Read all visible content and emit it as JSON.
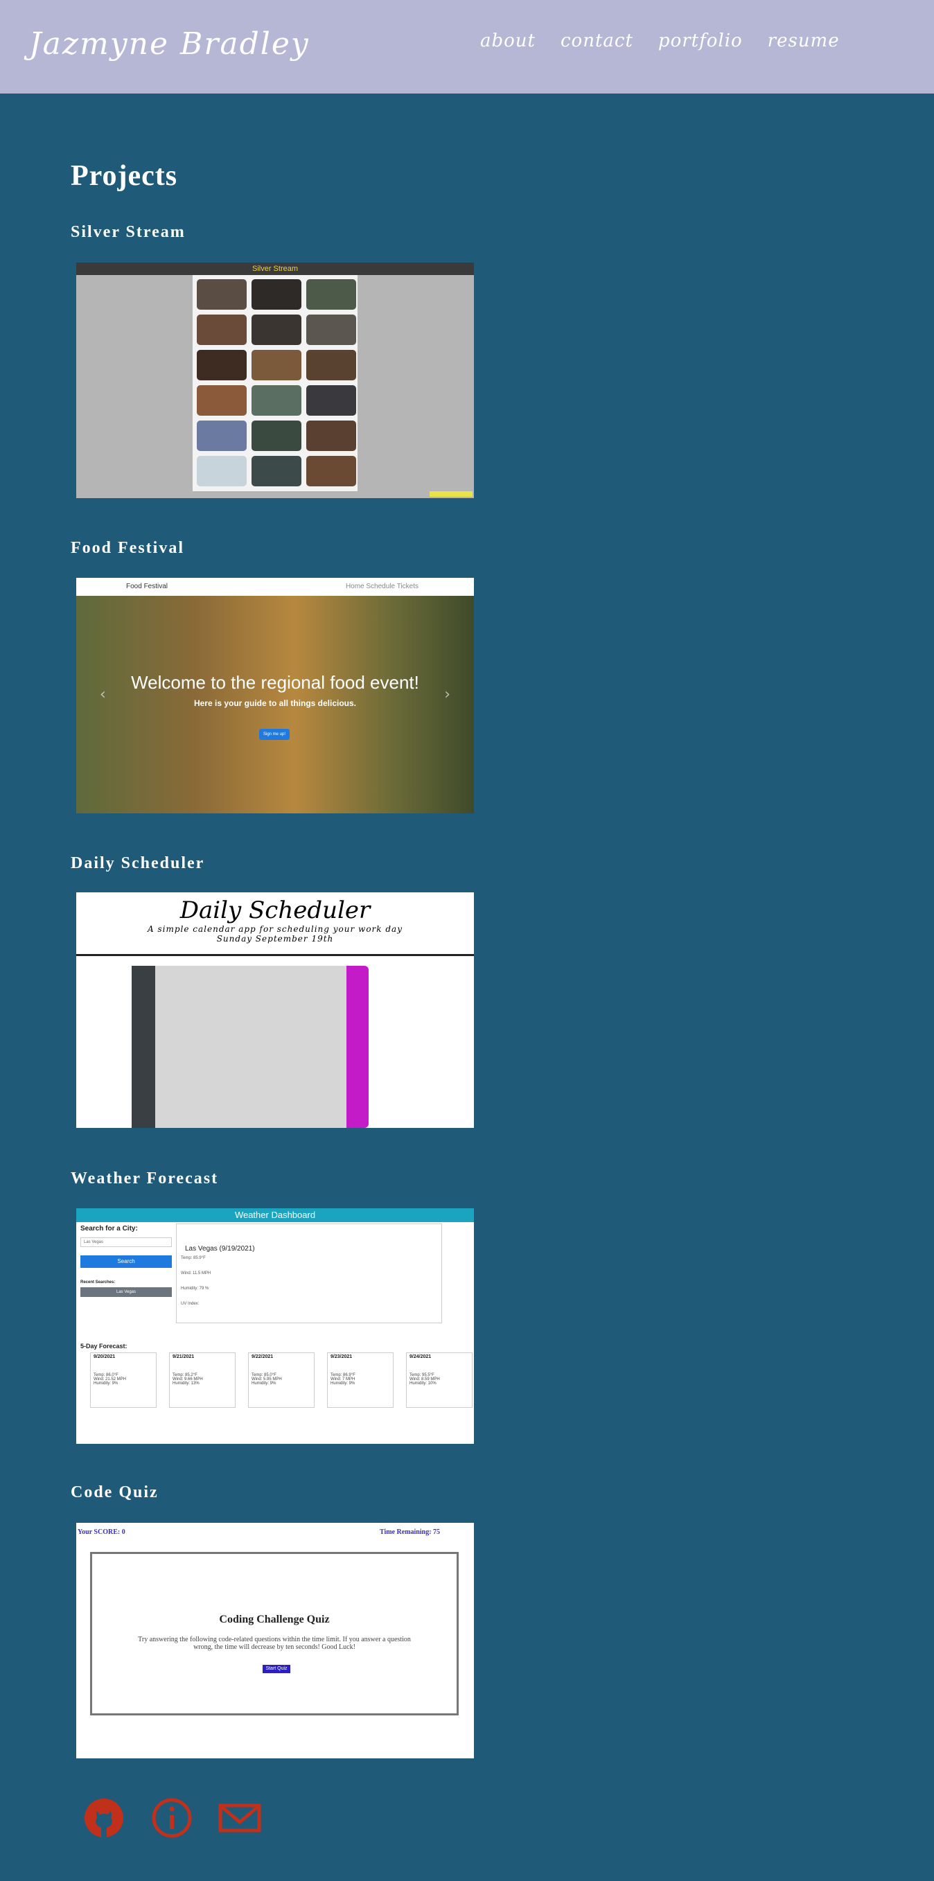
{
  "header": {
    "brand": "Jazmyne Bradley",
    "nav": [
      "about",
      "contact",
      "portfolio",
      "resume"
    ]
  },
  "main": {
    "title": "Projects",
    "projects": [
      {
        "title": "Silver Stream",
        "preview": {
          "bar": "Silver Stream"
        }
      },
      {
        "title": "Food Festival",
        "preview": {
          "brand": "Food Festival",
          "links": "Home  Schedule  Tickets",
          "headline": "Welcome to the regional food event!",
          "subhead": "Here is your guide to all things delicious.",
          "button": "Sign me up!"
        }
      },
      {
        "title": "Daily Scheduler",
        "preview": {
          "heading": "Daily Scheduler",
          "subtitle": "A simple calendar app for scheduling your work day",
          "date": "Sunday September 19th"
        }
      },
      {
        "title": "Weather Forecast",
        "preview": {
          "bar": "Weather Dashboard",
          "search_label": "Search for a City:",
          "search_value": "Las Vegas",
          "search_button": "Search",
          "recent_label": "Recent Searches:",
          "recent_item": "Las Vegas",
          "current_city": "Las Vegas (9/19/2021)",
          "current_temp": "Temp: 85.9°F",
          "current_wind": "Wind: 11.5 MPH",
          "current_humidity": "Humidity: 79 %",
          "current_uv": "UV Index:",
          "forecast_label": "5-Day Forecast:",
          "days": [
            {
              "date": "9/20/2021",
              "temp": "Temp: 86.0°F",
              "wind": "Wind: 21.52 MPH",
              "hum": "Humidity: 9%"
            },
            {
              "date": "9/21/2021",
              "temp": "Temp: 85.2°F",
              "wind": "Wind: 9.66 MPH",
              "hum": "Humidity: 13%"
            },
            {
              "date": "9/22/2021",
              "temp": "Temp: 85.0°F",
              "wind": "Wind: 5.95 MPH",
              "hum": "Humidity: 9%"
            },
            {
              "date": "9/23/2021",
              "temp": "Temp: 86.9°F",
              "wind": "Wind: 7 MPH",
              "hum": "Humidity: 9%"
            },
            {
              "date": "9/24/2021",
              "temp": "Temp: 95.5°F",
              "wind": "Wind: 8.59 MPH",
              "hum": "Humidity: 10%"
            }
          ]
        }
      },
      {
        "title": "Code Quiz",
        "preview": {
          "score": "Your SCORE: 0",
          "time": "Time Remaining: 75",
          "quiz_title": "Coding Challenge Quiz",
          "quiz_desc": "Try answering the following code-related questions within the time limit. If you answer a question wrong, the time will decrease by ten seconds! Good Luck!",
          "start": "Start Quiz"
        }
      }
    ]
  },
  "footer": {
    "icons": [
      "github-icon",
      "info-icon",
      "email-icon"
    ],
    "icon_color": "#c0301a"
  },
  "colors": {
    "header_bg": "#b6b6d5",
    "page_bg": "#1f5a78"
  }
}
